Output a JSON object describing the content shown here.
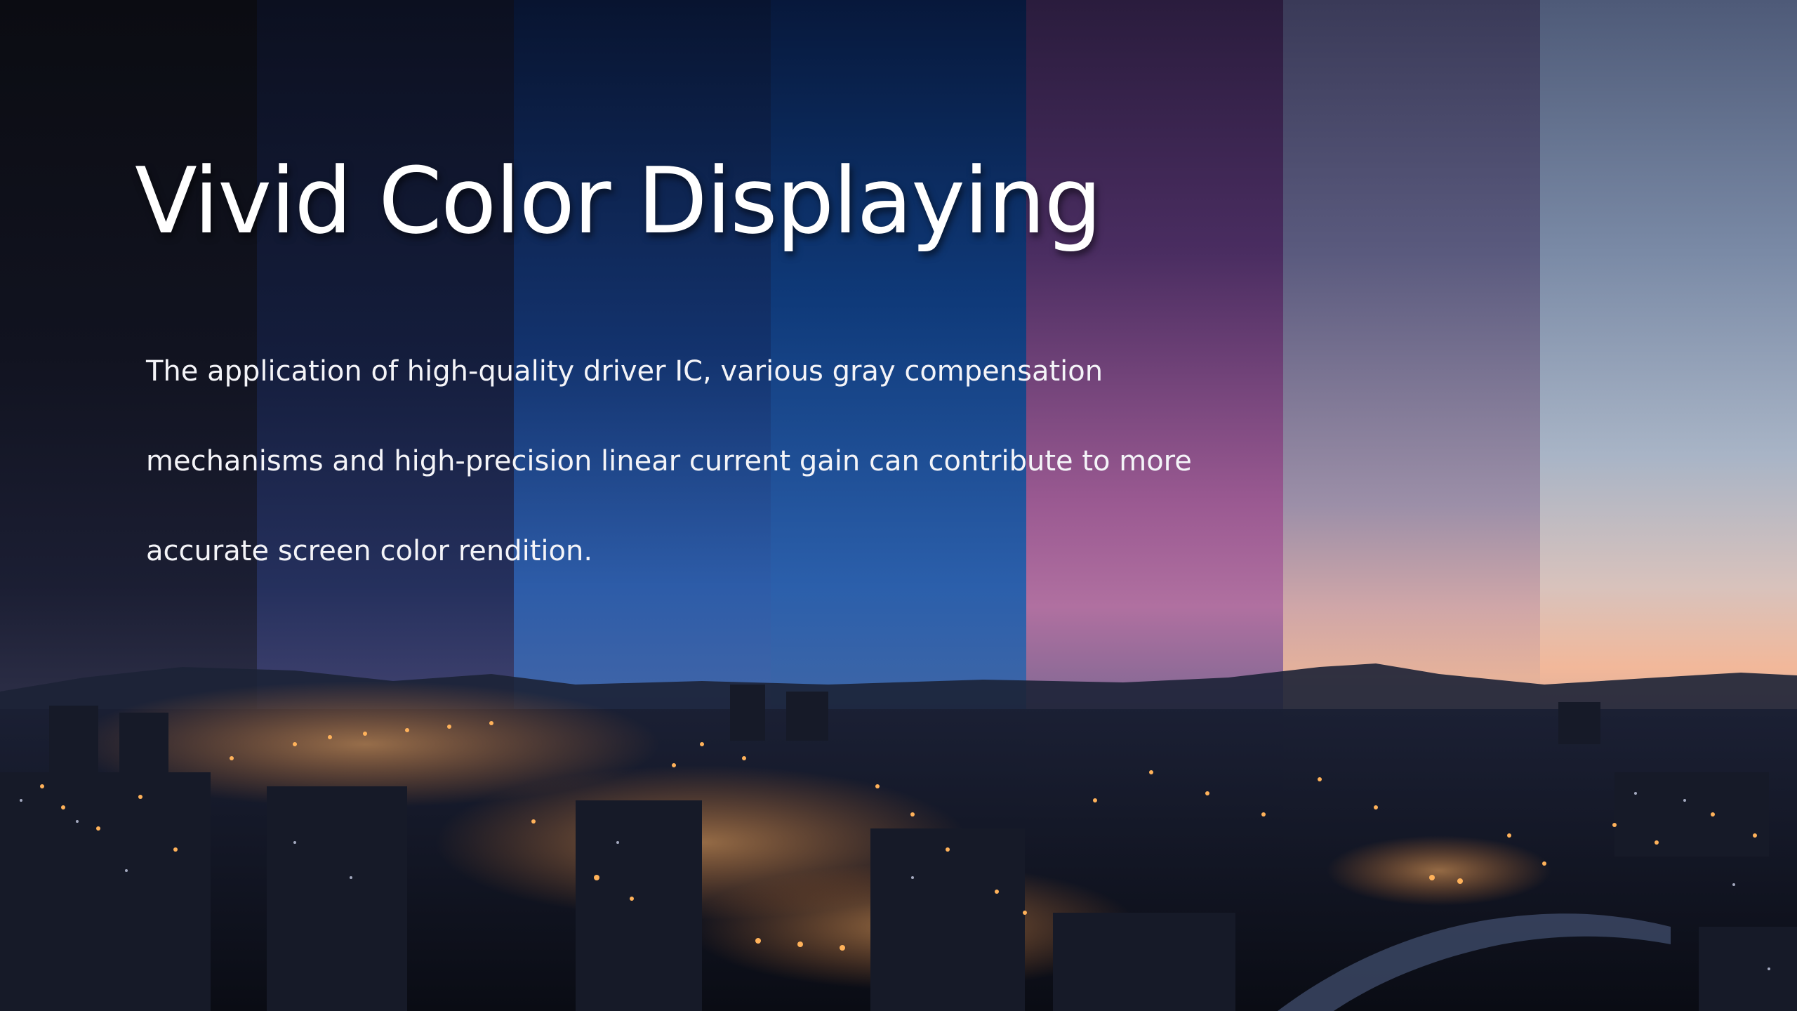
{
  "slide": {
    "title": "Vivid Color Displaying",
    "description_lines": [
      "The application of high-quality driver IC, various gray compensation",
      "mechanisms and high-precision linear current gain can contribute to more",
      "accurate screen color rendition."
    ]
  },
  "background": {
    "subject": "city-skyline-at-dusk-color-strips",
    "strip_colors": [
      "#1b1e33",
      "#25305d",
      "#2d5ca8",
      "#2b5fab",
      "#9b5a92",
      "#cfa6a8",
      "#d8c2bc"
    ],
    "city_light_color": "#ff9a3c"
  }
}
